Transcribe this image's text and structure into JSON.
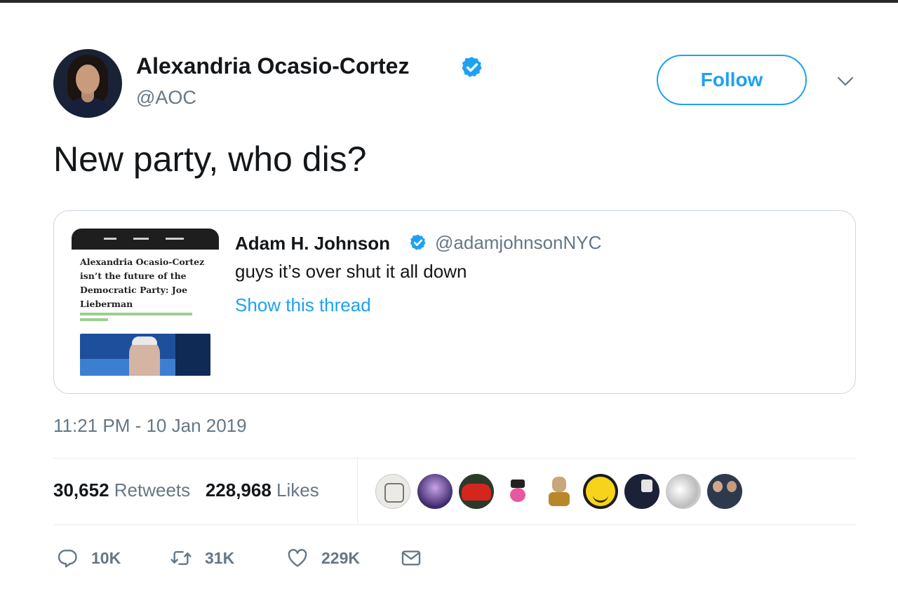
{
  "tweet": {
    "author_name": "Alexandria Ocasio-Cortez",
    "author_handle": "@AOC",
    "follow_label": "Follow",
    "text": "New party, who dis?",
    "timestamp": "11:21 PM - 10 Jan 2019"
  },
  "quoted": {
    "author_name": "Adam H. Johnson",
    "author_handle": "@adamjohnsonNYC",
    "text": "guys it’s over shut it all down",
    "show_thread": "Show this thread",
    "thumbnail_headline": "Alexandria Ocasio-Cortez isn’t the future of the Democratic Party: Joe Lieberman"
  },
  "stats": {
    "retweets_count": "30,652",
    "retweets_label": "Retweets",
    "likes_count": "228,968",
    "likes_label": "Likes"
  },
  "actions": {
    "reply_count": "10K",
    "retweet_count": "31K",
    "like_count": "229K"
  },
  "icons": {
    "verified": "verified-badge-icon",
    "caret": "chevron-down-icon",
    "reply": "reply-icon",
    "retweet": "retweet-icon",
    "like": "heart-icon",
    "dm": "envelope-icon"
  },
  "colors": {
    "accent": "#1da1f2",
    "muted": "#657786",
    "text": "#14171a",
    "border": "#ccd6dd"
  }
}
